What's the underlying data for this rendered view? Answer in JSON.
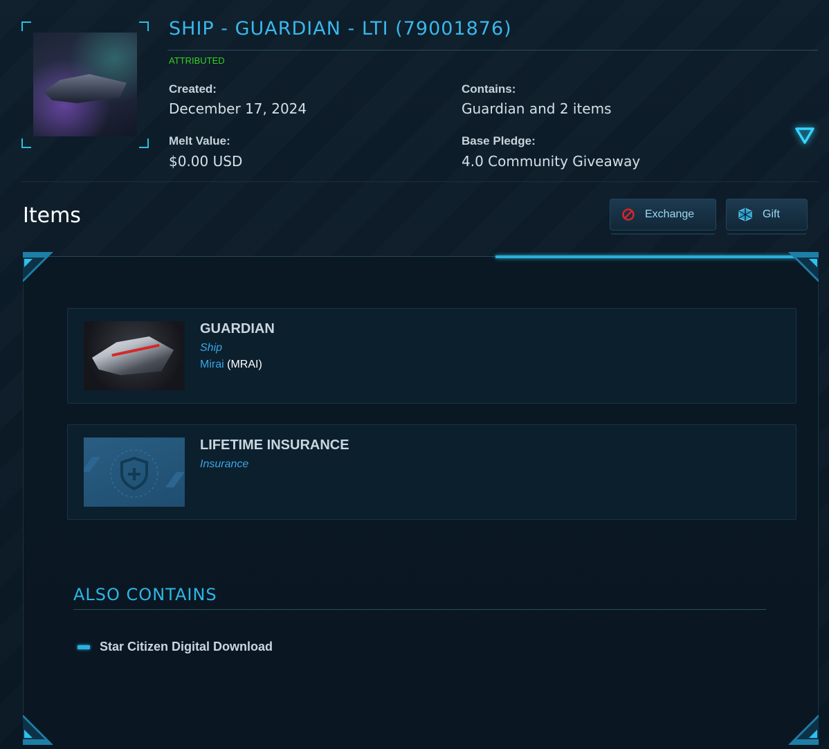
{
  "pledge": {
    "title": "SHIP - GUARDIAN - LTI (79001876)",
    "status": "ATTRIBUTED",
    "created_label": "Created:",
    "created_value": "December 17, 2024",
    "contains_label": "Contains:",
    "contains_value": "Guardian and 2 items",
    "melt_label": "Melt Value:",
    "melt_value": "$0.00 USD",
    "base_label": "Base Pledge:",
    "base_value": "4.0 Community Giveaway",
    "expand_icon": "triangle-down-icon"
  },
  "items_section": {
    "heading": "Items",
    "exchange_label": "Exchange",
    "exchange_icon": "no-entry-icon",
    "gift_label": "Gift",
    "gift_icon": "gift-box-icon"
  },
  "items": [
    {
      "title": "GUARDIAN",
      "type": "Ship",
      "manufacturer": "Mirai",
      "manufacturer_code": "(MRAI)"
    },
    {
      "title": "LIFETIME INSURANCE",
      "type": "Insurance"
    }
  ],
  "also_contains": {
    "heading": "ALSO CONTAINS",
    "items": [
      "Star Citizen Digital Download"
    ]
  },
  "colors": {
    "accent": "#39b8ec",
    "status_green": "#34d01f",
    "background": "#0b1a26",
    "exchange_red": "#d9242a"
  }
}
